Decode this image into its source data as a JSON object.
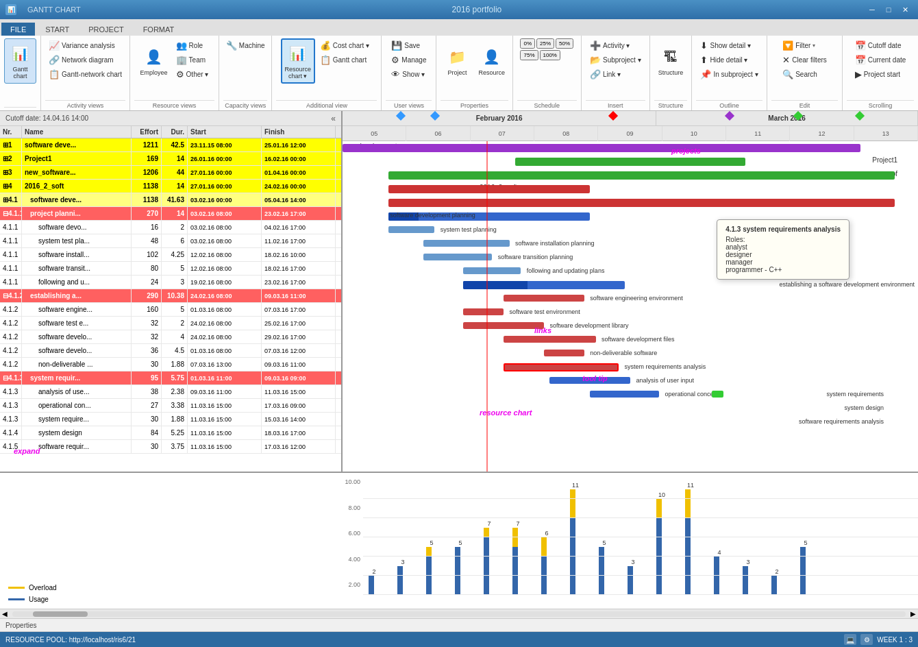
{
  "titlebar": {
    "app_tab": "GANTT CHART",
    "title": "2016 portfolio",
    "close": "✕",
    "maximize": "□",
    "minimize": "─"
  },
  "ribbon": {
    "tabs": [
      "FILE",
      "START",
      "PROJECT",
      "FORMAT"
    ],
    "active_tab": "START",
    "groups": {
      "activity_views": {
        "label": "Activity views",
        "items": [
          "Variance analysis",
          "Network diagram",
          "Gantt-network chart"
        ]
      },
      "gantt_btn": {
        "label": "Gantt\nchart"
      },
      "resource_views": {
        "label": "Resource views",
        "items": [
          "Role",
          "Team",
          "Other ▾"
        ],
        "employee": "Employee"
      },
      "capacity_views": {
        "label": "Capacity views",
        "items": [
          "Machine"
        ]
      },
      "additional_views": {
        "label": "Additional view",
        "items": [
          "Cost chart ▾",
          "Gantt chart"
        ]
      },
      "resource_chart_btn": {
        "label": "Resource chart ▾"
      },
      "user_views": {
        "label": "User views",
        "items": [
          "Save",
          "Manage",
          "Show ▾"
        ]
      },
      "properties": {
        "label": "Properties",
        "items": [
          "Project",
          "Resource"
        ]
      },
      "schedule": {
        "label": "Schedule",
        "items": [
          "0%",
          "25%",
          "50%",
          "75%",
          "100%"
        ]
      },
      "insert": {
        "label": "Insert",
        "items": [
          "Activity ▾",
          "Subproject ▾",
          "Link ▾"
        ]
      },
      "structure": {
        "label": "Structure"
      },
      "outline": {
        "label": "Outline",
        "items": [
          "Show detail ▾",
          "Hide detail ▾",
          "In subproject ▾"
        ]
      },
      "edit": {
        "label": "Edit",
        "items": [
          "Filter",
          "Clear filters",
          "Search"
        ]
      },
      "scrolling": {
        "label": "Scrolling",
        "items": [
          "Cutoff date",
          "Current date",
          "Project start"
        ]
      }
    }
  },
  "gantt": {
    "cutoff_label": "Cutoff date: 14.04.16 14:00",
    "columns": {
      "nr": "Nr.",
      "name": "Name",
      "effort": "Effort",
      "duration": "Dur.",
      "start": "Start",
      "finish": "Finish"
    },
    "rows": [
      {
        "nr": "1",
        "name": "software deve...",
        "effort": "1211",
        "dur": "42.5",
        "start": "23.11.15 08:00",
        "finish": "25.01.16 12:00",
        "level": 0,
        "highlight": false
      },
      {
        "nr": "2",
        "name": "Project1",
        "effort": "169",
        "dur": "14",
        "start": "26.01.16 00:00",
        "finish": "16.02.16 00:00",
        "level": 0,
        "highlight": false
      },
      {
        "nr": "3",
        "name": "new_software...",
        "effort": "1206",
        "dur": "44",
        "start": "27.01.16 00:00",
        "finish": "01.04.16 00:00",
        "level": 0,
        "highlight": false
      },
      {
        "nr": "4",
        "name": "2016_2_soft",
        "effort": "1138",
        "dur": "14",
        "start": "27.01.16 00:00",
        "finish": "24.02.16 00:00",
        "level": 0,
        "highlight": false
      },
      {
        "nr": "4.1",
        "name": "software deve...",
        "effort": "1138",
        "dur": "41.63",
        "start": "03.02.16 00:00",
        "finish": "05.04.16 14:00",
        "level": 1,
        "highlight": false
      },
      {
        "nr": "4.1.1",
        "name": "project planni...",
        "effort": "270",
        "dur": "14",
        "start": "03.02.16 08:00",
        "finish": "23.02.16 17:00",
        "level": "1-5",
        "highlight": true
      },
      {
        "nr": "4.1.1",
        "name": "software devo...",
        "effort": "16",
        "dur": "2",
        "start": "03.02.16 08:00",
        "finish": "04.02.16 17:00",
        "level": 2,
        "highlight": false
      },
      {
        "nr": "4.1.1",
        "name": "system test pla...",
        "effort": "48",
        "dur": "6",
        "start": "03.02.16 08:00",
        "finish": "11.02.16 17:00",
        "level": 2,
        "highlight": false
      },
      {
        "nr": "4.1.1",
        "name": "software install...",
        "effort": "102",
        "dur": "4.25",
        "start": "12.02.16 08:00",
        "finish": "18.02.16 10:00",
        "level": 2,
        "highlight": false
      },
      {
        "nr": "4.1.1",
        "name": "software transit...",
        "effort": "80",
        "dur": "5",
        "start": "12.02.16 08:00",
        "finish": "18.02.16 17:00",
        "level": 2,
        "highlight": false
      },
      {
        "nr": "4.1.1",
        "name": "following and u...",
        "effort": "24",
        "dur": "3",
        "start": "19.02.16 08:00",
        "finish": "23.02.16 17:00",
        "level": 2,
        "highlight": false
      },
      {
        "nr": "4.1.2",
        "name": "establishing a...",
        "effort": "290",
        "dur": "10.38",
        "start": "24.02.16 08:00",
        "finish": "09.03.16 11:00",
        "level": "1-5",
        "highlight": true
      },
      {
        "nr": "4.1.2",
        "name": "software engine...",
        "effort": "160",
        "dur": "5",
        "start": "01.03.16 08:00",
        "finish": "07.03.16 17:00",
        "level": 2,
        "highlight": false
      },
      {
        "nr": "4.1.2",
        "name": "software test e...",
        "effort": "32",
        "dur": "2",
        "start": "24.02.16 08:00",
        "finish": "25.02.16 17:00",
        "level": 2,
        "highlight": false
      },
      {
        "nr": "4.1.2",
        "name": "software develo...",
        "effort": "32",
        "dur": "4",
        "start": "24.02.16 08:00",
        "finish": "29.02.16 17:00",
        "level": 2,
        "highlight": false
      },
      {
        "nr": "4.1.2",
        "name": "software develo...",
        "effort": "36",
        "dur": "4.5",
        "start": "01.03.16 08:00",
        "finish": "07.03.16 12:00",
        "level": 2,
        "highlight": false
      },
      {
        "nr": "4.1.2",
        "name": "non-deliverable ...",
        "effort": "30",
        "dur": "1.88",
        "start": "07.03.16 13:00",
        "finish": "09.03.16 11:00",
        "level": 2,
        "highlight": false
      },
      {
        "nr": "4.1.3",
        "name": "system requir...",
        "effort": "95",
        "dur": "5.75",
        "start": "01.03.16 11:00",
        "finish": "09.03.16 09:00",
        "level": "1-5",
        "highlight": true
      },
      {
        "nr": "4.1.3",
        "name": "analysis of use...",
        "effort": "38",
        "dur": "2.38",
        "start": "09.03.16 11:00",
        "finish": "11.03.16 15:00",
        "level": 2,
        "highlight": false
      },
      {
        "nr": "4.1.3",
        "name": "operational con...",
        "effort": "27",
        "dur": "3.38",
        "start": "11.03.16 15:00",
        "finish": "17.03.16 09:00",
        "level": 2,
        "highlight": false
      },
      {
        "nr": "4.1.3",
        "name": "system require...",
        "effort": "30",
        "dur": "1.88",
        "start": "11.03.16 15:00",
        "finish": "15.03.16 14:00",
        "level": 2,
        "highlight": false
      },
      {
        "nr": "4.1.4",
        "name": "system design",
        "effort": "84",
        "dur": "5.25",
        "start": "11.03.16 15:00",
        "finish": "18.03.16 17:00",
        "level": 2,
        "highlight": false
      },
      {
        "nr": "4.1.5",
        "name": "software requir...",
        "effort": "30",
        "dur": "3.75",
        "start": "11.03.16 15:00",
        "finish": "17.03.16 12:00",
        "level": 2,
        "highlight": false
      }
    ]
  },
  "chart": {
    "months": [
      "February 2016",
      "March 2016"
    ],
    "weeks": [
      "05",
      "06",
      "07",
      "08",
      "09",
      "10",
      "11",
      "12",
      "13"
    ],
    "annotations": {
      "projects": "projects",
      "links": "links",
      "tool_tip": "tool tip",
      "resource_chart": "resource chart",
      "expand": "expand"
    },
    "tooltip": {
      "title": "4.1.3 system requirements analysis",
      "roles_label": "Roles:",
      "roles": [
        "analyst",
        "designer",
        "manager",
        "programmer - C++"
      ]
    }
  },
  "resource_chart": {
    "legend": {
      "overload_label": "Overload",
      "usage_label": "Usage"
    },
    "y_axis": [
      "10.00",
      "8.00",
      "6.00",
      "4.00",
      "2.00"
    ],
    "bars": [
      {
        "pos": 0,
        "usage": 2,
        "overload": 0
      },
      {
        "pos": 1,
        "usage": 3,
        "overload": 0
      },
      {
        "pos": 2,
        "usage": 4,
        "overload": 1
      },
      {
        "pos": 3,
        "usage": 5,
        "overload": 0
      },
      {
        "pos": 4,
        "usage": 6,
        "overload": 1
      },
      {
        "pos": 5,
        "usage": 5,
        "overload": 2
      },
      {
        "pos": 6,
        "usage": 4,
        "overload": 2
      },
      {
        "pos": 7,
        "usage": 8,
        "overload": 3
      },
      {
        "pos": 8,
        "usage": 5,
        "overload": 0
      },
      {
        "pos": 9,
        "usage": 3,
        "overload": 0
      },
      {
        "pos": 10,
        "usage": 8,
        "overload": 2
      },
      {
        "pos": 11,
        "usage": 8,
        "overload": 3
      },
      {
        "pos": 12,
        "usage": 4,
        "overload": 0
      },
      {
        "pos": 13,
        "usage": 3,
        "overload": 0
      },
      {
        "pos": 14,
        "usage": 2,
        "overload": 0
      },
      {
        "pos": 15,
        "usage": 5,
        "overload": 0
      }
    ]
  },
  "status_bar": {
    "resource_pool": "RESOURCE POOL: http://localhost/ris6/21",
    "week_info": "WEEK 1 : 3"
  },
  "properties_panel": {
    "label": "Properties"
  }
}
